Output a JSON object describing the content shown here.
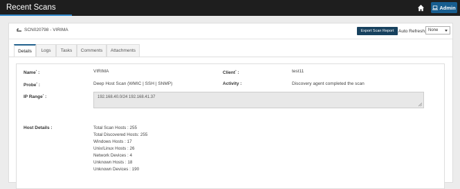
{
  "app": {
    "title": "Recent Scans",
    "admin_label": "Admin"
  },
  "header": {
    "scan_title": "SCN020798 - VIRIMA",
    "export_label": "Export Scan Report",
    "auto_refresh_label": "Auto Refresh:",
    "auto_refresh_value": "None"
  },
  "tabs": [
    {
      "label": "Details"
    },
    {
      "label": "Logs"
    },
    {
      "label": "Tasks"
    },
    {
      "label": "Comments"
    },
    {
      "label": "Attachments"
    }
  ],
  "details": {
    "name_label": "Name",
    "name_value": "VIRIMA",
    "client_label": "Client",
    "client_value": "test11",
    "probe_label": "Probe",
    "probe_value": "Deep Host Scan (WMIC | SSH | SNMP)",
    "activity_label": "Activity :",
    "activity_value": "Discovery agent completed the scan",
    "ip_label": "IP Range",
    "ip_value": "192.168.40.0/24 192.168.41.37",
    "host_label": "Host Details :",
    "host_lines": [
      "Total Scan Hosts : 255",
      "Total Discovered Hosts: 255",
      "Windows Hosts : 17",
      "Unix/Linux Hosts : 26",
      "Network Devices : 4",
      "Unknown Hosts : 18",
      "Unknown Devices : 190"
    ]
  }
}
